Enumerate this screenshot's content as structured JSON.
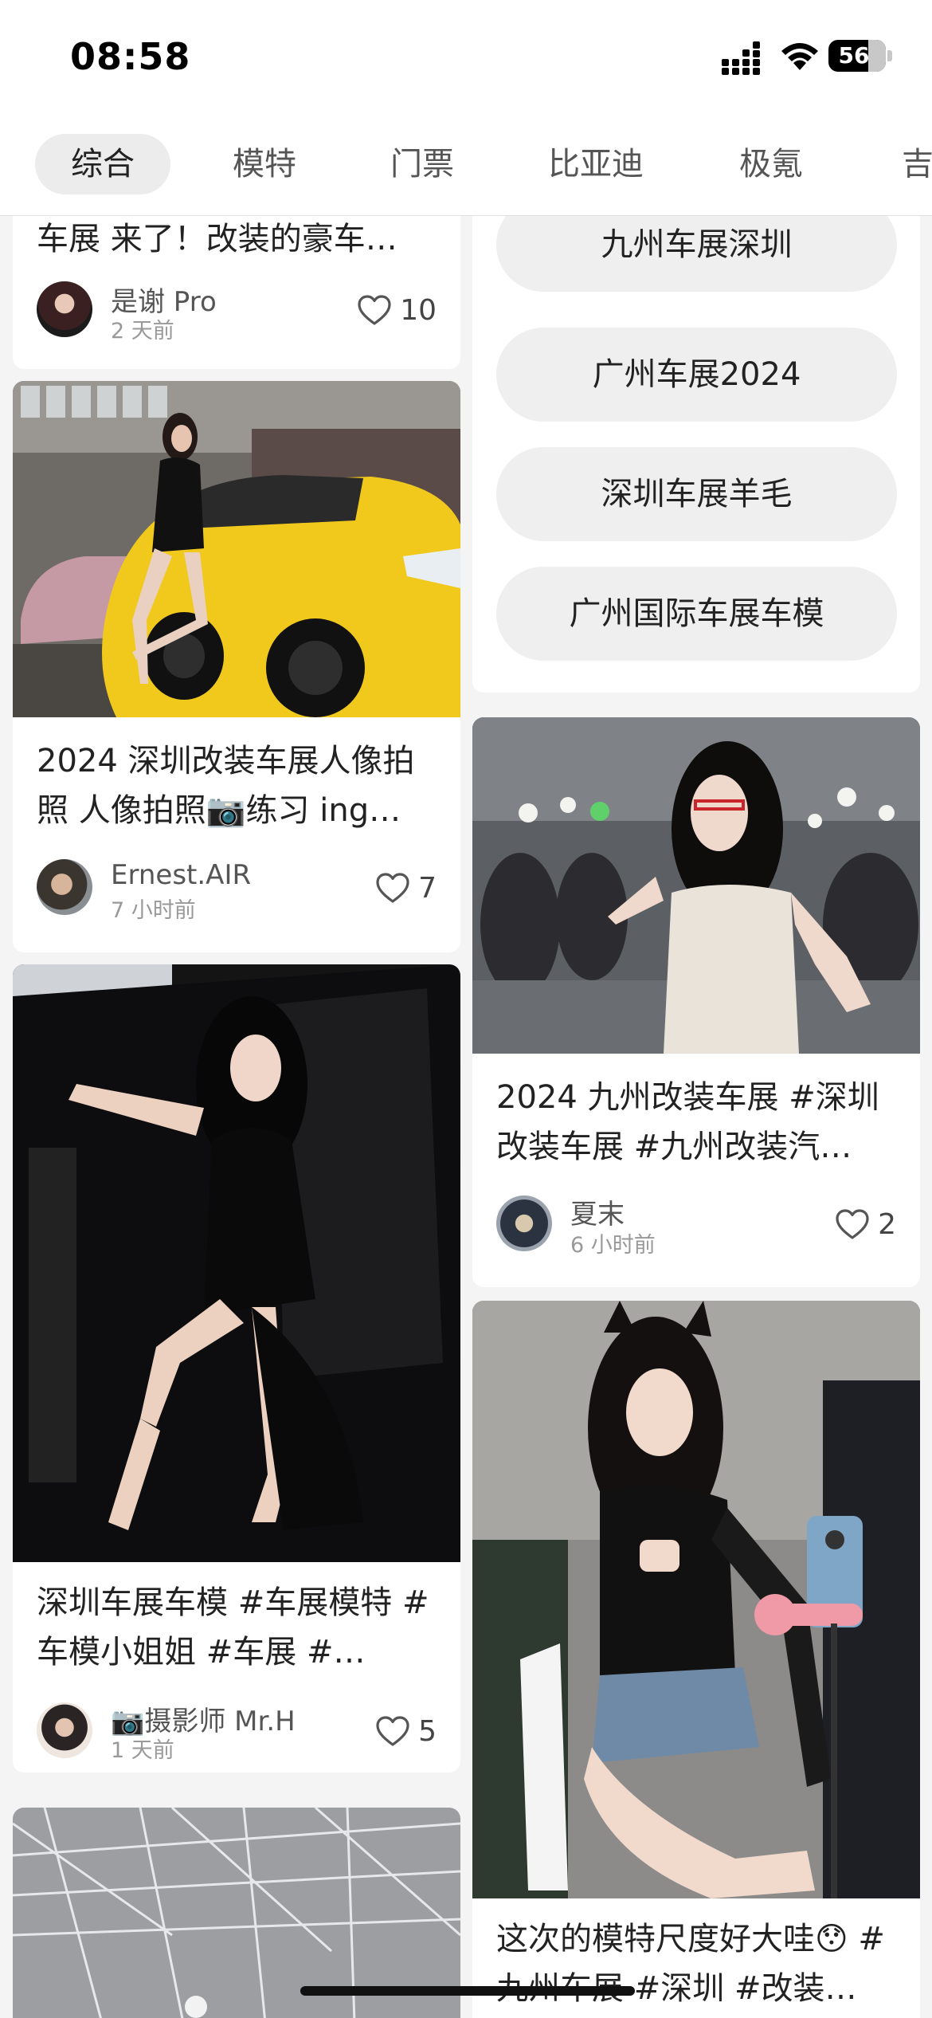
{
  "status_bar": {
    "time": "08:58",
    "battery": "56"
  },
  "tabs": [
    {
      "label": "综合",
      "active": true
    },
    {
      "label": "模特",
      "active": false
    },
    {
      "label": "门票",
      "active": false
    },
    {
      "label": "比亚迪",
      "active": false
    },
    {
      "label": "极氪",
      "active": false
    },
    {
      "label": "吉",
      "active": false
    }
  ],
  "left_column": [
    {
      "title": "车展 来了！改装的豪车…",
      "author": "是谢 Pro",
      "time": "2 天前",
      "likes": "10"
    },
    {
      "title": "2024 深圳改装车展人像拍照 人像拍照📷练习 ing…",
      "author": "Ernest.AIR",
      "time": "7 小时前",
      "likes": "7"
    },
    {
      "title": "深圳车展车模 #车展模特 #车模小姐姐 #车展 #…",
      "author": "📷摄影师 Mr.H",
      "time": "1 天前",
      "likes": "5"
    }
  ],
  "search_suggestions": [
    "九州车展深圳",
    "广州车展2024",
    "深圳车展羊毛",
    "广州国际车展车模"
  ],
  "right_column": [
    {
      "title": "2024 九州改装车展 #深圳改装车展 #九州改装汽…",
      "author": "夏末",
      "time": "6 小时前",
      "likes": "2"
    },
    {
      "title": "这次的模特尺度好大哇😯 #九州车展 #深圳 #改装…"
    }
  ]
}
